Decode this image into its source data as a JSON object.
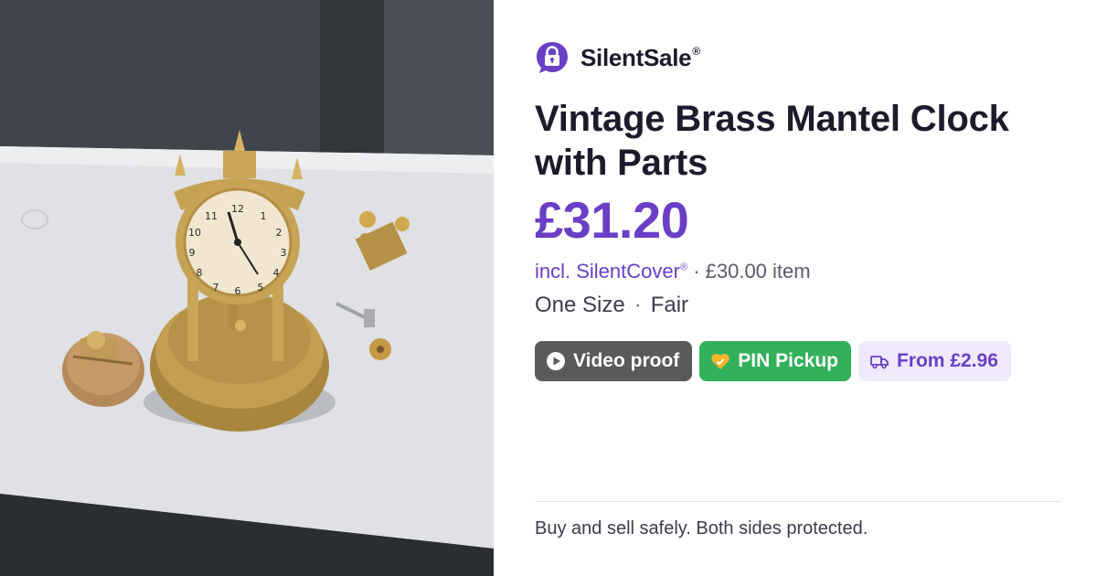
{
  "brand": {
    "name": "SilentSale",
    "mark": "®"
  },
  "listing": {
    "title": "Vintage Brass Mantel Clock with Parts",
    "price": "£31.20",
    "fee_label": "incl. SilentCover",
    "fee_mark": "®",
    "item_price": "· £30.00 item",
    "size": "One Size",
    "condition": "Fair"
  },
  "badges": {
    "video": "Video proof",
    "pin": "PIN Pickup",
    "shipping": "From £2.96"
  },
  "footer": {
    "tagline": "Buy and sell safely. Both sides protected."
  },
  "colors": {
    "accent": "#6a3fc6",
    "video_badge": "#5a5a5c",
    "pin_badge": "#33b05a",
    "ship_badge_bg": "#efe9fb"
  },
  "icons": [
    "padlock-chat-icon",
    "play-icon",
    "heart-shield-icon",
    "truck-icon"
  ]
}
